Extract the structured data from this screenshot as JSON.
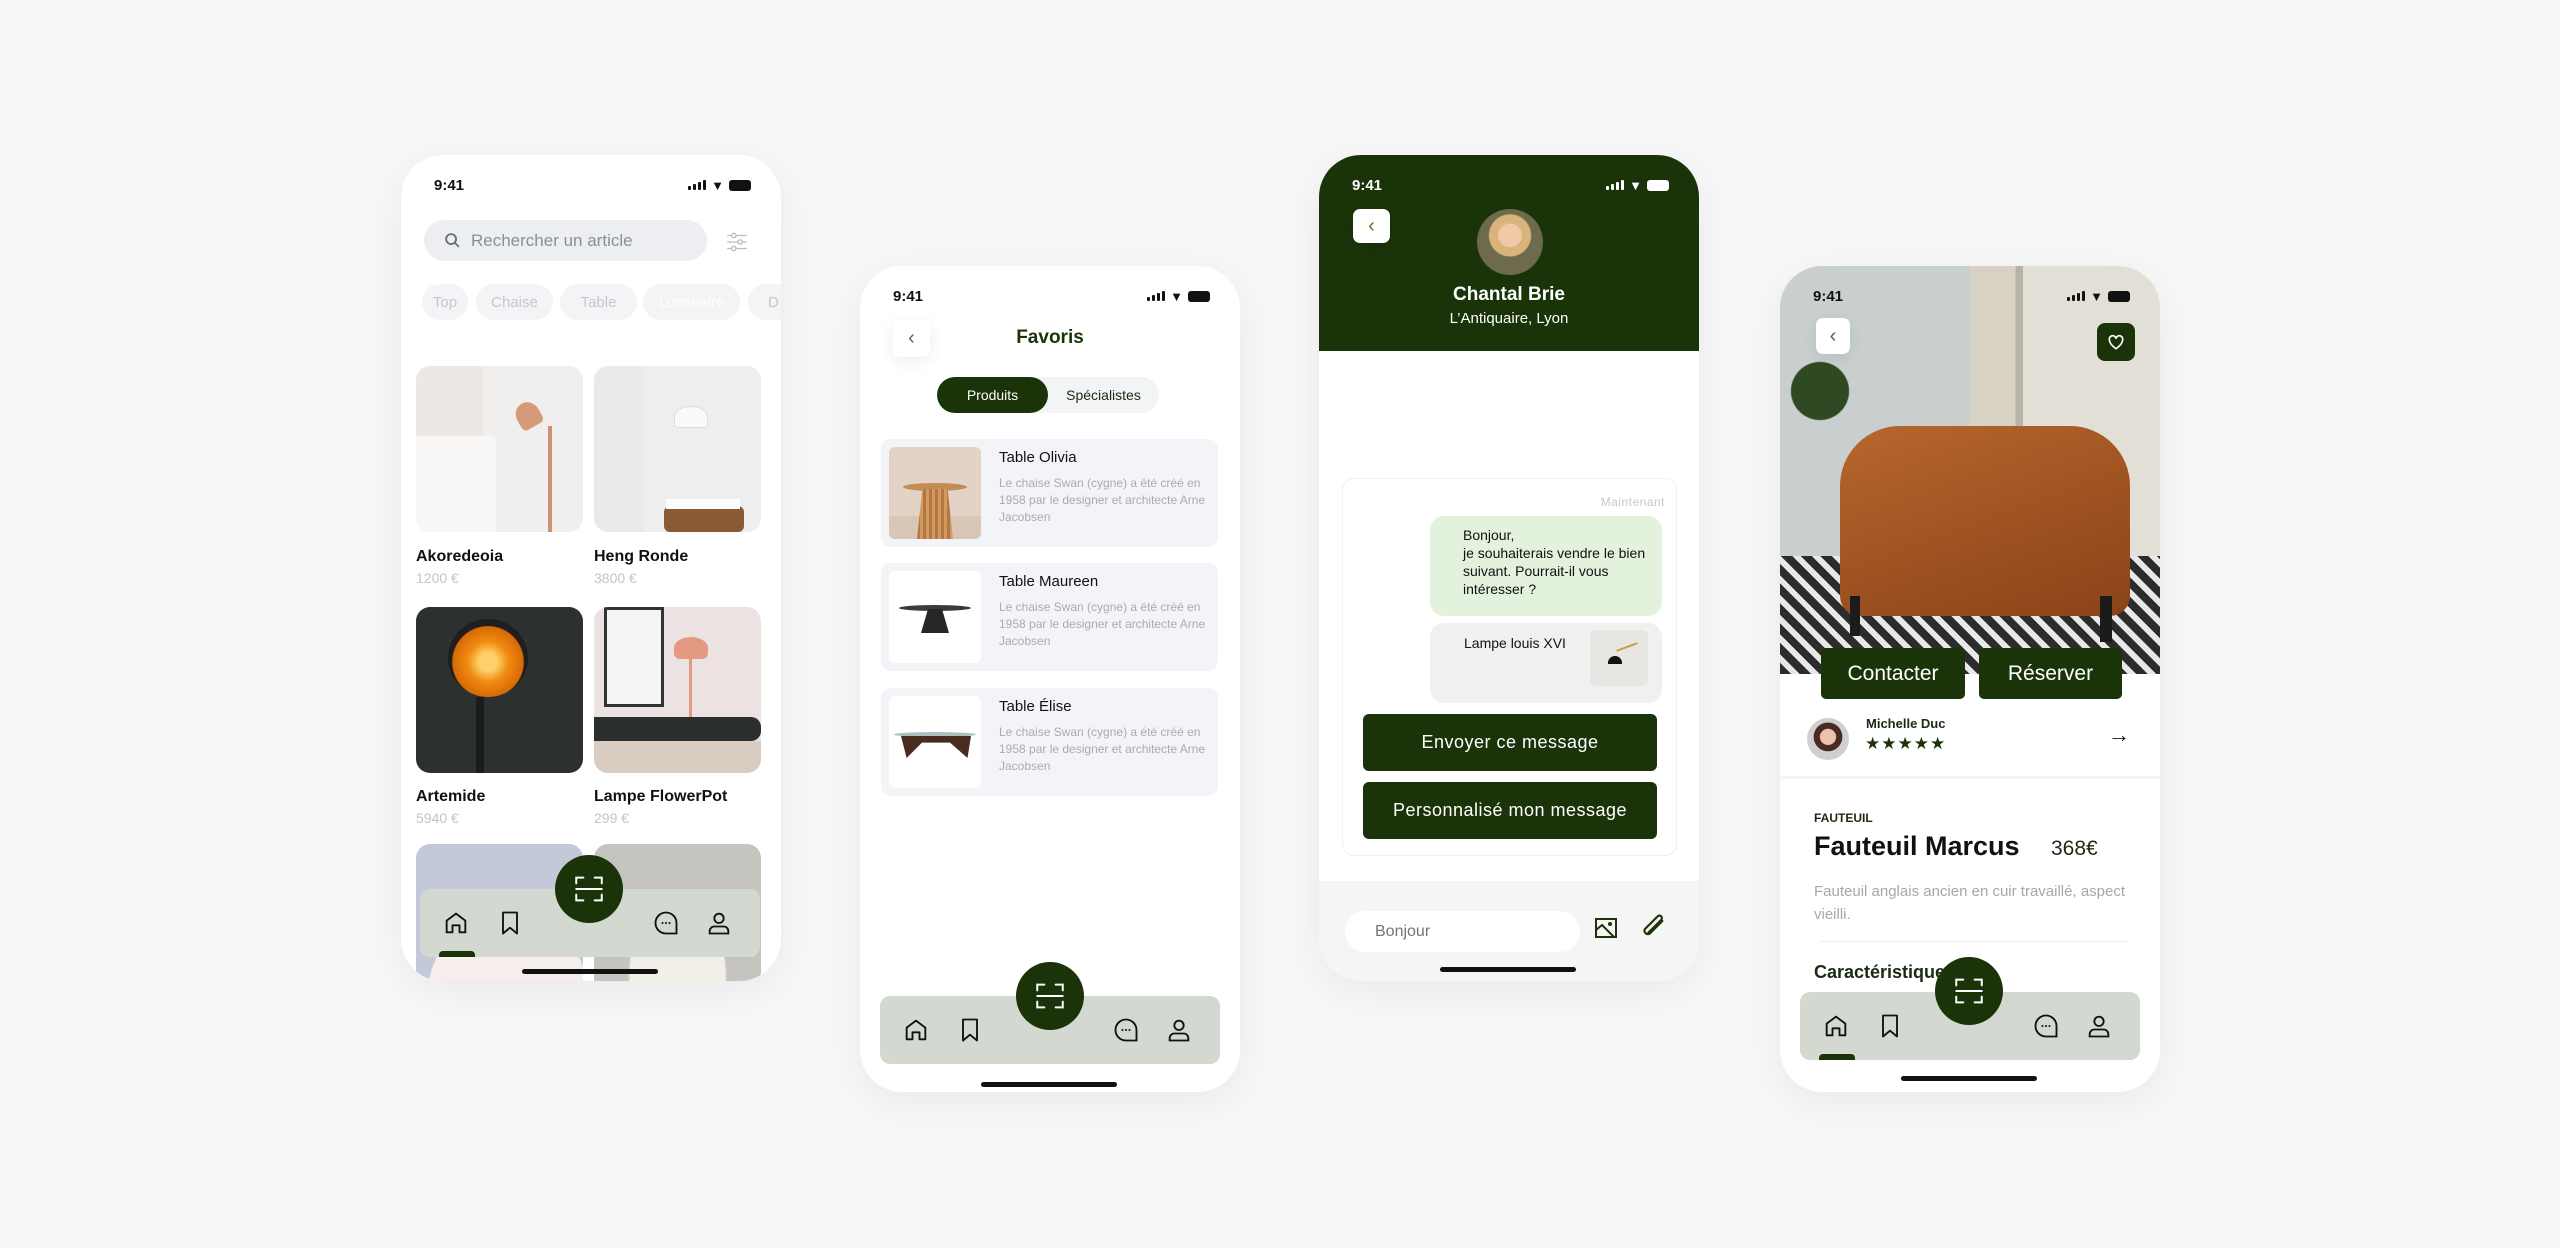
{
  "colors": {
    "brand": "#1a3309",
    "nav": "#d3d8d0",
    "bubble": "#e2f2dc"
  },
  "status_time": "9:41",
  "screen_home": {
    "search_placeholder": "Rechercher un article",
    "chips": [
      "Top",
      "Chaise",
      "Table",
      "Luminaire",
      "D"
    ],
    "active_chip": "Luminaire",
    "products": [
      {
        "name": "Akoredeoia",
        "price": "1200 €"
      },
      {
        "name": "Heng Ronde",
        "price": "3800 €"
      },
      {
        "name": "Artemide",
        "price": "5940 €"
      },
      {
        "name": "Lampe FlowerPot",
        "price": "299 €"
      }
    ]
  },
  "screen_favorites": {
    "title": "Favoris",
    "tabs": [
      "Produits",
      "Spécialistes"
    ],
    "active_tab": "Produits",
    "items": [
      {
        "title": "Table Olivia",
        "desc": "Le chaise Swan (cygne) a été créé en 1958 par le designer et architecte Arne Jacobsen"
      },
      {
        "title": "Table Maureen",
        "desc": "Le chaise Swan (cygne) a été créé en 1958 par le designer et architecte Arne Jacobsen"
      },
      {
        "title": "Table Élise",
        "desc": "Le chaise Swan (cygne) a été créé en 1958 par le designer et architecte Arne Jacobsen"
      }
    ]
  },
  "screen_chat": {
    "contact_name": "Chantal Brie",
    "contact_subtitle": "L’Antiquaire, Lyon",
    "timestamp": "Maintenant",
    "message": "Bonjour,\nje souhaiterais vendre le bien suivant. Pourrait-il vous intéresser ?",
    "attachment_label": "Lampe louis XVI",
    "send_button": "Envoyer ce message",
    "customize_button": "Personnalisé mon message",
    "input_placeholder": "Bonjour"
  },
  "screen_product": {
    "contact_button": "Contacter",
    "reserve_button": "Réserver",
    "seller_name": "Michelle Duc",
    "seller_rating": 5,
    "category": "FAUTEUIL",
    "title": "Fauteuil Marcus",
    "price": "368€",
    "description": "Fauteuil anglais ancien en cuir travaillé, aspect vieilli.",
    "section_title": "Caractéristiques"
  }
}
